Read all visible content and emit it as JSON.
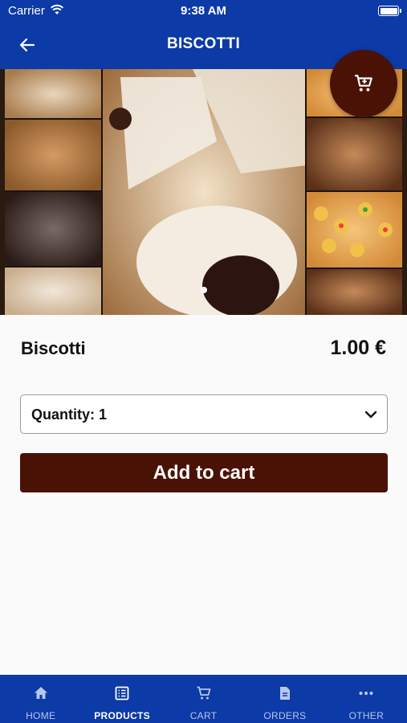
{
  "status_bar": {
    "carrier": "Carrier",
    "time": "9:38 AM"
  },
  "header": {
    "title": "BISCOTTI"
  },
  "hero": {
    "slide_count": 1,
    "active_slide": 1
  },
  "product": {
    "name": "Biscotti",
    "price": "1.00 €"
  },
  "quantity_select": {
    "label": "Quantity: 1"
  },
  "add_to_cart": {
    "label": "Add to cart"
  },
  "tab_bar": {
    "tabs": [
      {
        "label": "HOME",
        "icon": "home-icon",
        "active": false
      },
      {
        "label": "PRODUCTS",
        "icon": "list-icon",
        "active": true
      },
      {
        "label": "CART",
        "icon": "cart-icon",
        "active": false
      },
      {
        "label": "ORDERS",
        "icon": "document-icon",
        "active": false
      },
      {
        "label": "OTHER",
        "icon": "more-icon",
        "active": false
      }
    ]
  },
  "colors": {
    "primary": "#0c3aa6",
    "accent": "#4a1205",
    "background": "#fafafa"
  }
}
